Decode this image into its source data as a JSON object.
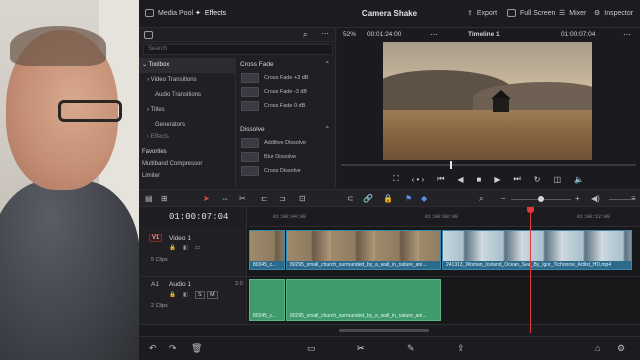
{
  "topbar": {
    "media_pool": "Media Pool",
    "effects": "Effects",
    "title": "Camera Shake",
    "export": "Export",
    "full_screen": "Full Screen",
    "mixer": "Mixer",
    "inspector": "Inspector"
  },
  "effects_panel": {
    "search_placeholder": "Search",
    "toolbox": "Toolbox",
    "tree": [
      "Video Transitions",
      "Audio Transitions",
      "Titles",
      "Generators",
      "Effects"
    ],
    "favorites_label": "Favorites",
    "favorites": [
      "Multiband Compressor",
      "Limiter"
    ],
    "cross_fade_cat": "Cross Fade",
    "cross_fade_items": [
      "Cross Fade +3 dB",
      "Cross Fade -3 dB",
      "Cross Fade 0 dB"
    ],
    "dissolve_cat": "Dissolve",
    "dissolve_items": [
      "Additive Dissolve",
      "Blur Dissolve",
      "Cross Dissolve"
    ]
  },
  "viewer": {
    "zoom": "52%",
    "source_timecode": "00:01:24:00",
    "timeline_name": "Timeline 1",
    "record_timecode": "01:00:07:04"
  },
  "timeline": {
    "timecode": "01:00:07:04",
    "ruler_ticks": [
      "01:00:04:00",
      "01:00:08:00",
      "01:00:12:00"
    ],
    "video_track": {
      "tag": "V1",
      "name": "Video 1",
      "clip_count": "5 Clips",
      "clips": [
        "80345_c...",
        "80295_small_church_surrounded_by_a_wall_in_nature_ani...",
        "241313_Woman_Iceland_Ocean_Sea_By_Igor_Tichonow_Artlist_HD.mp4"
      ]
    },
    "audio_track": {
      "tag": "A1",
      "name": "Audio 1",
      "level": "2.0",
      "s_btn": "S",
      "m_btn": "M",
      "clip_count": "2 Clips",
      "clips": [
        "80345_c...",
        "80295_small_church_surrounded_by_a_wall_in_nature_ani..."
      ]
    }
  }
}
